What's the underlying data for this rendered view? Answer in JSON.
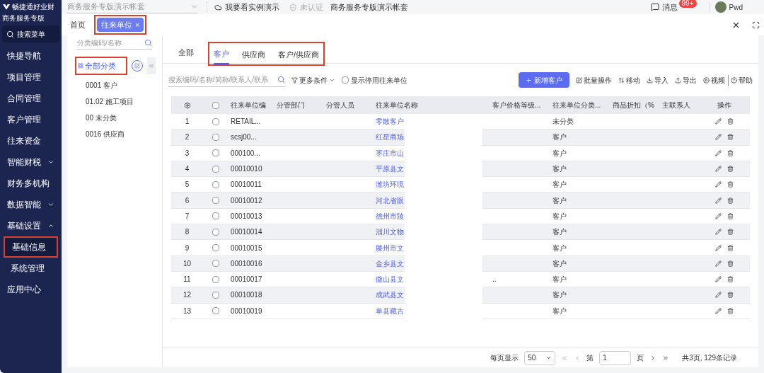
{
  "brand": {
    "name": "畅捷通好业财",
    "edition": "商务服务专版"
  },
  "topbar": {
    "account_select": "商务服务专版演示帐套",
    "demo_link": "我要看实例演示",
    "cert_status": "未认证",
    "account_name": "商务服务专版演示帐套",
    "messages": "消息",
    "badge": "99+",
    "user": "Pwd"
  },
  "sidebar": {
    "search": "搜索菜单",
    "items": [
      {
        "label": "快捷导航",
        "selected": false
      },
      {
        "label": "项目管理",
        "selected": false
      },
      {
        "label": "合同管理",
        "selected": false
      },
      {
        "label": "客户管理",
        "selected": false
      },
      {
        "label": "往来资金",
        "selected": false
      },
      {
        "label": "智能财税",
        "expanded": false,
        "selected": false
      },
      {
        "label": "财务多机构",
        "selected": false
      },
      {
        "label": "数据智能",
        "expanded": false,
        "selected": false
      },
      {
        "label": "基础设置",
        "expanded": true,
        "selected": false,
        "children": [
          {
            "label": "基础信息",
            "selected": true
          },
          {
            "label": "系统管理",
            "selected": false
          }
        ]
      },
      {
        "label": "应用中心",
        "selected": false
      }
    ]
  },
  "page_tabs": [
    {
      "label": "首页",
      "selected": false
    },
    {
      "label": "往来单位",
      "selected": true,
      "close": "×"
    }
  ],
  "category_panel": {
    "search_placeholder": "分类编码/名称",
    "root": "全部分类",
    "items": [
      "0001 客户",
      "01.02 施工项目",
      "00 未分类",
      "0016 供应商"
    ]
  },
  "type_tabs": [
    {
      "label": "全部",
      "selected": false
    },
    {
      "label": "客户",
      "selected": true
    },
    {
      "label": "供应商",
      "selected": false
    },
    {
      "label": "客户/供应商",
      "selected": false
    }
  ],
  "toolbar": {
    "search_placeholder": "搜索编码/名称/简称/联系人/联系",
    "more": "更多条件",
    "show_disabled": {
      "label": "显示停用往来单位",
      "checked": false
    },
    "new": "新增客户",
    "actions": [
      "批量操作",
      "移动",
      "导入",
      "导出",
      "视频",
      "帮助"
    ]
  },
  "table": {
    "select_all_checked": false,
    "columns": [
      "往来单位编",
      "分管部门",
      "分管人员",
      "往来单位名称",
      "客户价格等级...",
      "往来单位分类...",
      "商品折扣（%",
      "主联系人",
      "操作"
    ],
    "rows": [
      {
        "no": "1",
        "code": "RETAIL...",
        "name": "零散客户",
        "price_level": "",
        "category": "未分类",
        "checked": false
      },
      {
        "no": "2",
        "code": "scsj00...",
        "name": "红星商场",
        "price_level": "",
        "category": "客户",
        "checked": false
      },
      {
        "no": "3",
        "code": "000100...",
        "name": "枣庄市山",
        "price_level": "",
        "category": "客户",
        "checked": false
      },
      {
        "no": "4",
        "code": "00010010",
        "name": "平原县文",
        "price_level": "",
        "category": "客户",
        "checked": false
      },
      {
        "no": "5",
        "code": "00010011",
        "name": "潍坊环境",
        "price_level": "",
        "category": "客户",
        "checked": false
      },
      {
        "no": "6",
        "code": "00010012",
        "name": "河北省眼",
        "price_level": "",
        "category": "客户",
        "checked": false
      },
      {
        "no": "7",
        "code": "00010013",
        "name": "德州市陵",
        "price_level": "",
        "category": "客户",
        "checked": false
      },
      {
        "no": "8",
        "code": "00010014",
        "name": "淄川文物",
        "price_level": "",
        "category": "客户",
        "checked": false
      },
      {
        "no": "9",
        "code": "00010015",
        "name": "滕州市文",
        "price_level": "",
        "category": "客户",
        "checked": false
      },
      {
        "no": "10",
        "code": "00010016",
        "name": "金乡县文",
        "price_level": "",
        "category": "客户",
        "checked": false
      },
      {
        "no": "11",
        "code": "00010017",
        "name": "微山县文",
        "price_level": "..",
        "category": "客户",
        "checked": false
      },
      {
        "no": "12",
        "code": "00010018",
        "name": "成武县文",
        "price_level": "",
        "category": "客户",
        "checked": false
      },
      {
        "no": "13",
        "code": "00010019",
        "name": "单县藏古",
        "price_level": "",
        "category": "客户",
        "checked": false
      }
    ]
  },
  "pagination": {
    "page_size_label": "每页显示",
    "page_size": "50",
    "page_prefix": "第",
    "page": "1",
    "page_suffix": "页",
    "summary": "共3页, 129条记录"
  }
}
